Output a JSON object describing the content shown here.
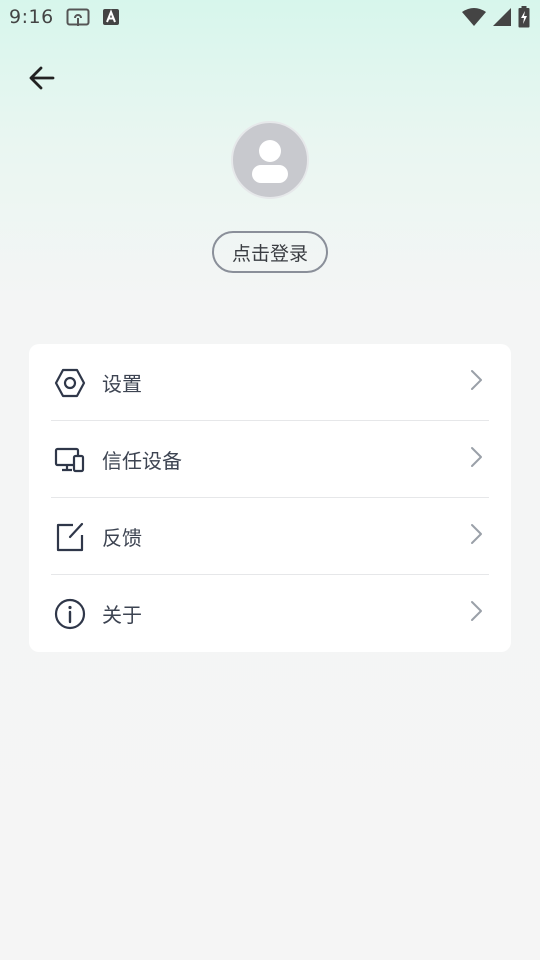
{
  "status_bar": {
    "time": "9:16",
    "left_icons": [
      "cast-icon",
      "a-badge-icon"
    ],
    "right_icons": [
      "wifi-icon",
      "cellular-signal-icon",
      "battery-charging-icon"
    ]
  },
  "header": {
    "back_icon": "arrow-left-icon"
  },
  "profile": {
    "avatar_icon": "user-avatar-icon",
    "login_label": "点击登录"
  },
  "menu": {
    "items": [
      {
        "label": "设置",
        "icon": "hexagon-settings-icon"
      },
      {
        "label": "信任设备",
        "icon": "devices-icon"
      },
      {
        "label": "反馈",
        "icon": "edit-feedback-icon"
      },
      {
        "label": "关于",
        "icon": "info-icon"
      }
    ],
    "chevron_icon": "chevron-right-icon"
  },
  "colors": {
    "accent_text": "#3d4452",
    "card_bg": "#ffffff",
    "page_bg": "#f5f5f5",
    "header_gradient_top": "#d7f6ec",
    "avatar_bg": "#c8c9ce"
  }
}
